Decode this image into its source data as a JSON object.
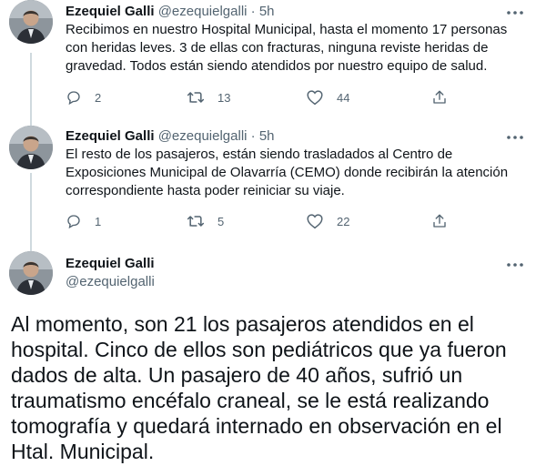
{
  "tweets": [
    {
      "name": "Ezequiel Galli",
      "handle": "@ezequielgalli",
      "separator": "·",
      "time": "5h",
      "text": "Recibimos en nuestro Hospital Municipal, hasta el momento 17 personas con heridas leves. 3 de ellas con fracturas, ninguna reviste heridas de gravedad. Todos están siendo atendidos por nuestro equipo de salud.",
      "replies": "2",
      "retweets": "13",
      "likes": "44"
    },
    {
      "name": "Ezequiel Galli",
      "handle": "@ezequielgalli",
      "separator": "·",
      "time": "5h",
      "text": "El resto de los pasajeros, están siendo trasladados al Centro de Exposiciones Municipal de Olavarría (CEMO) donde recibirán la atención correspondiente hasta poder reiniciar su viaje.",
      "replies": "1",
      "retweets": "5",
      "likes": "22"
    }
  ],
  "focused_tweet": {
    "name": "Ezequiel Galli",
    "handle": "@ezequielgalli",
    "text": "Al momento, son 21 los pasajeros atendidos en el hospital. Cinco de ellos son pediátricos que ya fueron dados de alta. Un pasajero de 40 años, sufrió un traumatismo encéfalo craneal, se le está realizando tomografía y quedará internado en observación en el Htal. Municipal."
  },
  "icons": {
    "more": "more-horizontal-icon",
    "reply": "reply-icon",
    "retweet": "retweet-icon",
    "like": "heart-icon",
    "share": "share-icon"
  },
  "colors": {
    "text": "#0f1419",
    "secondary": "#536471",
    "thread_line": "#cfd9de"
  }
}
